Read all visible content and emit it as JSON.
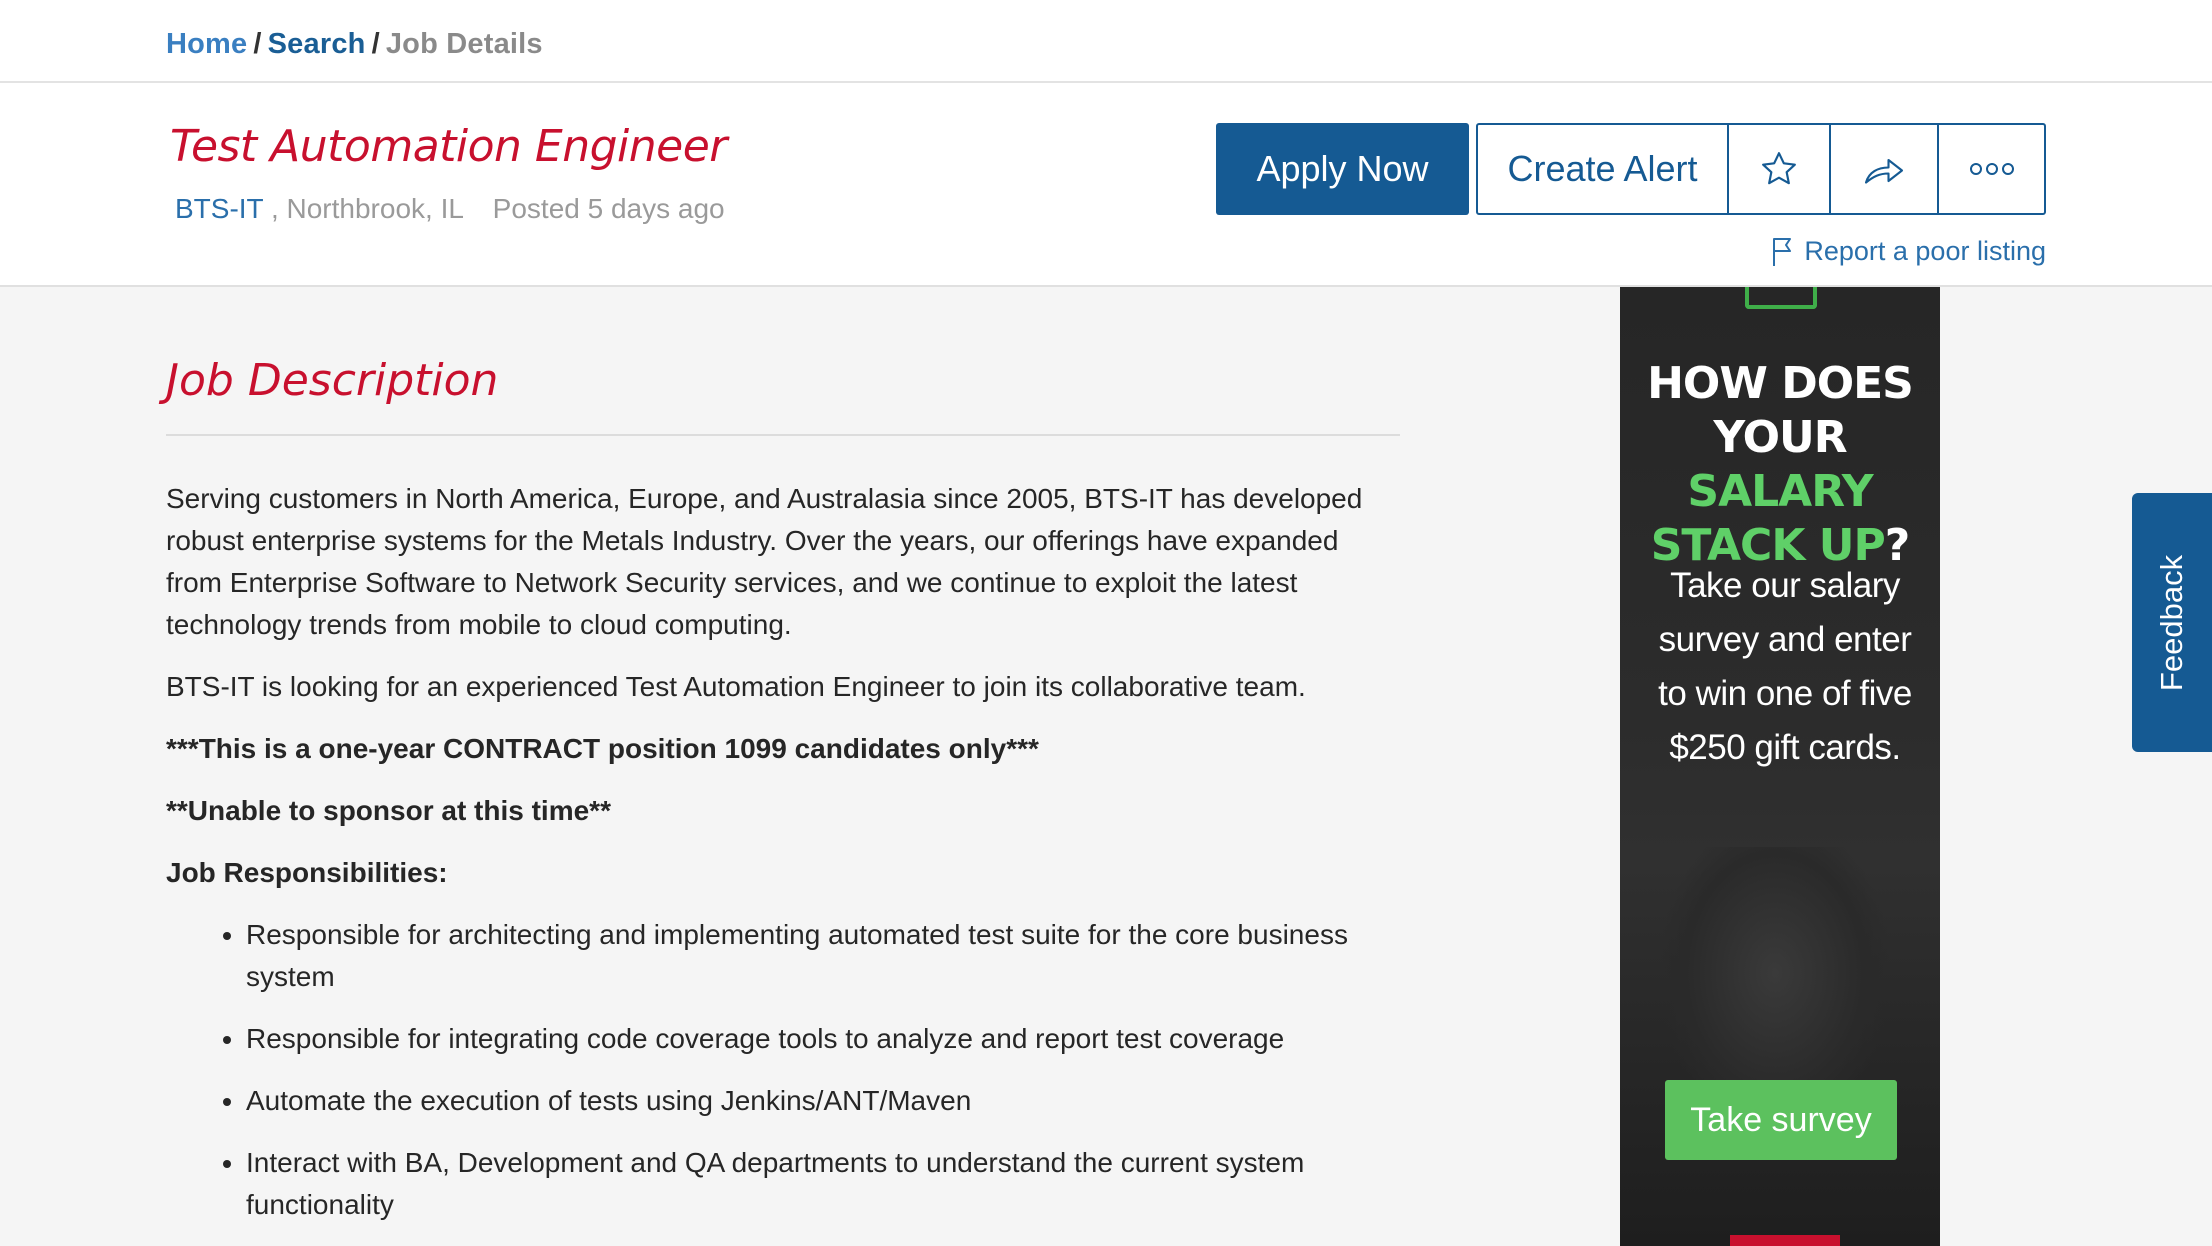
{
  "breadcrumb": {
    "home": "Home",
    "search": "Search",
    "current": "Job Details",
    "separator": "/"
  },
  "job": {
    "title": "Test Automation Engineer",
    "company": "BTS-IT",
    "location_sep": ",",
    "location": "Northbrook, IL",
    "posted": "Posted 5 days ago"
  },
  "actions": {
    "apply_label": "Apply Now",
    "alert_label": "Create Alert",
    "star_icon": "star-icon",
    "share_icon": "share-icon",
    "more_icon": "more-icon",
    "report_label": "Report a poor listing",
    "brand_color": "#155a93"
  },
  "description": {
    "heading": "Job Description",
    "paragraph1": "Serving customers in North America, Europe, and Australasia since 2005, BTS-IT has developed robust enterprise systems for the Metals Industry. Over the years, our offerings have expanded from Enterprise Software to Network Security services, and we continue to exploit the latest technology trends from mobile to cloud computing.",
    "paragraph2": "BTS-IT is looking for an experienced Test Automation Engineer to join its collaborative team.",
    "contract_note": "***This is a one-year CONTRACT position 1099 candidates only***",
    "sponsor_note": "**Unable to sponsor at this time**",
    "responsibilities_heading": "Job Responsibilities:",
    "responsibilities": [
      "Responsible for architecting and implementing automated test suite for the core business system",
      "Responsible for integrating code coverage tools to analyze and report test coverage",
      "Automate the execution of tests using Jenkins/ANT/Maven",
      "Interact with BA, Development and QA departments to understand the current system functionality"
    ]
  },
  "ad": {
    "line1": "HOW DOES",
    "line2_white": "YOUR ",
    "line2_green": "SALARY",
    "line3_green": "STACK UP",
    "line3_white": "?",
    "body": "Take our salary survey and enter to win one of five $250 gift cards.",
    "button_label": "Take survey",
    "accent_color": "#5cc15e"
  },
  "feedback": {
    "label": "Feedback"
  }
}
